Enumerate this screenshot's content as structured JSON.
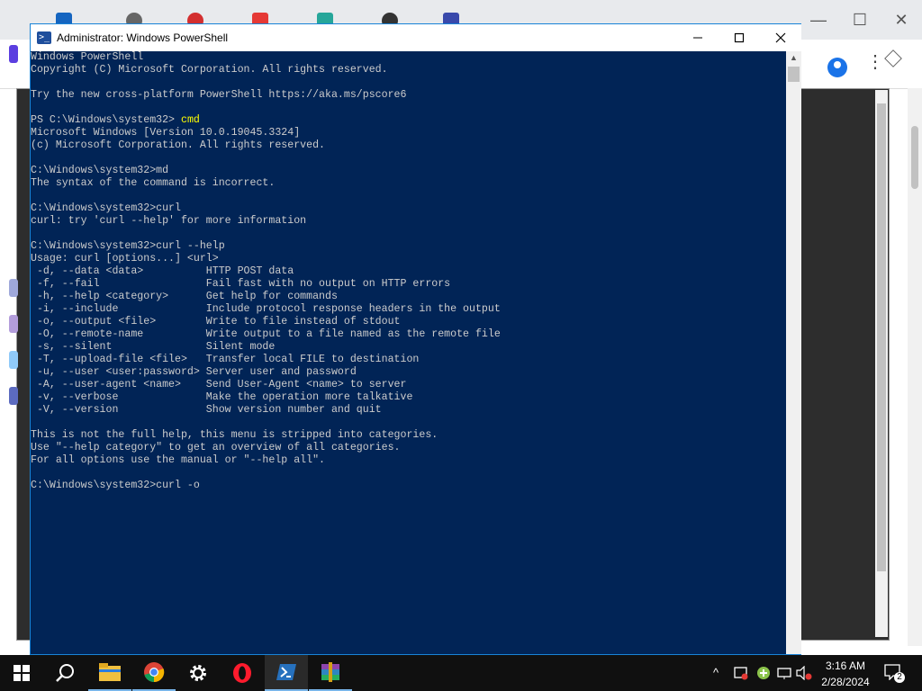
{
  "powershell": {
    "title": "Administrator: Windows PowerShell",
    "icon_glyph": ">_",
    "controls": {
      "minimize": "—",
      "maximize": "☐",
      "close": "✕"
    },
    "lines": [
      "Windows PowerShell",
      "Copyright (C) Microsoft Corporation. All rights reserved.",
      "",
      "Try the new cross-platform PowerShell https://aka.ms/pscore6",
      "",
      "PS C:\\Windows\\system32> ",
      "Microsoft Windows [Version 10.0.19045.3324]",
      "(c) Microsoft Corporation. All rights reserved.",
      "",
      "C:\\Windows\\system32>md",
      "The syntax of the command is incorrect.",
      "",
      "C:\\Windows\\system32>curl",
      "curl: try 'curl --help' for more information",
      "",
      "C:\\Windows\\system32>curl --help",
      "Usage: curl [options...] <url>",
      " -d, --data <data>          HTTP POST data",
      " -f, --fail                 Fail fast with no output on HTTP errors",
      " -h, --help <category>      Get help for commands",
      " -i, --include              Include protocol response headers in the output",
      " -o, --output <file>        Write to file instead of stdout",
      " -O, --remote-name          Write output to a file named as the remote file",
      " -s, --silent               Silent mode",
      " -T, --upload-file <file>   Transfer local FILE to destination",
      " -u, --user <user:password> Server user and password",
      " -A, --user-agent <name>    Send User-Agent <name> to server",
      " -v, --verbose              Make the operation more talkative",
      " -V, --version              Show version number and quit",
      "",
      "This is not the full help, this menu is stripped into categories.",
      "Use \"--help category\" to get an overview of all categories.",
      "For all options use the manual or \"--help all\".",
      "",
      "C:\\Windows\\system32>curl -o"
    ],
    "ps_cmd": "cmd",
    "colors": {
      "background": "#012456",
      "text": "#cccccc",
      "command": "#ffff00"
    }
  },
  "browser": {
    "controls": {
      "minimize": "—",
      "maximize": "☐",
      "close": "✕"
    },
    "outer_close": "✕"
  },
  "taskbar": {
    "start_icon": "windows-start-icon",
    "apps": [
      "search-icon",
      "file-explorer-icon",
      "chrome-icon",
      "settings-icon",
      "opera-icon",
      "powershell-icon",
      "winrar-icon"
    ],
    "time": "3:16 AM",
    "date": "2/28/2024",
    "notification_count": "2",
    "tray_chevron": "^"
  }
}
